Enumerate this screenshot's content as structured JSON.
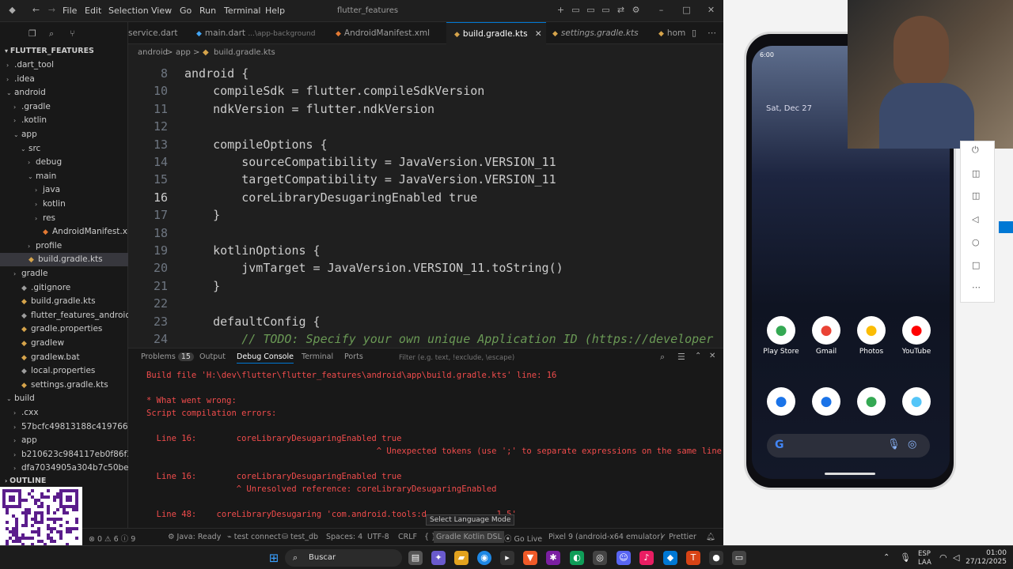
{
  "window": {
    "title": "flutter_features"
  },
  "menu": [
    "File",
    "Edit",
    "Selection",
    "View",
    "Go",
    "Run",
    "Terminal",
    "Help"
  ],
  "tabs": [
    {
      "label": "service.dart",
      "active": false
    },
    {
      "label": "main.dart",
      "hint": "...\\app-background",
      "active": false
    },
    {
      "label": "AndroidManifest.xml",
      "active": false
    },
    {
      "label": "build.gradle.kts",
      "active": true
    },
    {
      "label": "settings.gradle.kts",
      "active": false
    },
    {
      "label": "hom",
      "active": false
    }
  ],
  "breadcrumb": [
    "android",
    ">",
    "app",
    ">",
    "build.gradle.kts"
  ],
  "explorer": {
    "root": "FLUTTER_FEATURES",
    "items": [
      {
        "label": ".dart_tool",
        "depth": 1,
        "chev": ">"
      },
      {
        "label": ".idea",
        "depth": 1,
        "chev": ">"
      },
      {
        "label": "android",
        "depth": 1,
        "chev": "v"
      },
      {
        "label": ".gradle",
        "depth": 2,
        "chev": ">"
      },
      {
        "label": ".kotlin",
        "depth": 2,
        "chev": ">"
      },
      {
        "label": "app",
        "depth": 2,
        "chev": "v"
      },
      {
        "label": "src",
        "depth": 3,
        "chev": "v"
      },
      {
        "label": "debug",
        "depth": 4,
        "chev": ">"
      },
      {
        "label": "main",
        "depth": 4,
        "chev": "v"
      },
      {
        "label": "java",
        "depth": 5,
        "chev": ">"
      },
      {
        "label": "kotlin",
        "depth": 5,
        "chev": ">"
      },
      {
        "label": "res",
        "depth": 5,
        "chev": ">"
      },
      {
        "label": "AndroidManifest.xml",
        "depth": 5,
        "chev": ""
      },
      {
        "label": "profile",
        "depth": 4,
        "chev": ">"
      },
      {
        "label": "build.gradle.kts",
        "depth": 3,
        "chev": "",
        "selected": true
      },
      {
        "label": "gradle",
        "depth": 2,
        "chev": ">"
      },
      {
        "label": ".gitignore",
        "depth": 2,
        "chev": ""
      },
      {
        "label": "build.gradle.kts",
        "depth": 2,
        "chev": ""
      },
      {
        "label": "flutter_features_android.iml",
        "depth": 2,
        "chev": ""
      },
      {
        "label": "gradle.properties",
        "depth": 2,
        "chev": ""
      },
      {
        "label": "gradlew",
        "depth": 2,
        "chev": ""
      },
      {
        "label": "gradlew.bat",
        "depth": 2,
        "chev": ""
      },
      {
        "label": "local.properties",
        "depth": 2,
        "chev": ""
      },
      {
        "label": "settings.gradle.kts",
        "depth": 2,
        "chev": ""
      },
      {
        "label": "build",
        "depth": 1,
        "chev": "v"
      },
      {
        "label": ".cxx",
        "depth": 2,
        "chev": ">"
      },
      {
        "label": "57bcfc49813188c419766...",
        "depth": 2,
        "chev": ">"
      },
      {
        "label": "app",
        "depth": 2,
        "chev": ">"
      },
      {
        "label": "b210623c984117eb0f86f3...",
        "depth": 2,
        "chev": ">"
      },
      {
        "label": "dfa7034905a304b7c50be...",
        "depth": 2,
        "chev": ">"
      }
    ],
    "outline": "OUTLINE"
  },
  "code": [
    {
      "n": "8",
      "t": "android {"
    },
    {
      "n": "10",
      "t": "    compileSdk = flutter.compileSdkVersion"
    },
    {
      "n": "11",
      "t": "    ndkVersion = flutter.ndkVersion"
    },
    {
      "n": "12",
      "t": ""
    },
    {
      "n": "13",
      "t": "    compileOptions {"
    },
    {
      "n": "14",
      "t": "        sourceCompatibility = JavaVersion.VERSION_11"
    },
    {
      "n": "15",
      "t": "        targetCompatibility = JavaVersion.VERSION_11"
    },
    {
      "n": "16",
      "t": "        coreLibraryDesugaringEnabled true",
      "current": true
    },
    {
      "n": "17",
      "t": "    }"
    },
    {
      "n": "18",
      "t": ""
    },
    {
      "n": "19",
      "t": "    kotlinOptions {"
    },
    {
      "n": "20",
      "t": "        jvmTarget = JavaVersion.VERSION_11.toString()"
    },
    {
      "n": "21",
      "t": "    }"
    },
    {
      "n": "22",
      "t": ""
    },
    {
      "n": "23",
      "t": "    defaultConfig {"
    },
    {
      "n": "24",
      "t": "        // TODO: Specify your own unique Application ID (https://developer"
    }
  ],
  "panel": {
    "tabs": [
      "Problems",
      "Output",
      "Debug Console",
      "Terminal",
      "Ports"
    ],
    "problems_count": "15",
    "active_tab": "Debug Console",
    "filter_placeholder": "Filter (e.g. text, !exclude, \\escape)",
    "lines": [
      "Build file 'H:\\dev\\flutter\\flutter_features\\android\\app\\build.gradle.kts' line: 16",
      "",
      "* What went wrong:",
      "Script compilation errors:",
      "",
      "  Line 16:        coreLibraryDesugaringEnabled true",
      "                                              ^ Unexpected tokens (use ';' to separate expressions on the same line)",
      "",
      "  Line 16:        coreLibraryDesugaringEnabled true",
      "                  ^ Unresolved reference: coreLibraryDesugaringEnabled",
      "",
      "  Line 48:    coreLibraryDesugaring 'com.android.tools:d              1.5'"
    ],
    "tooltip": "Select Language Mode"
  },
  "status": {
    "errors": "0",
    "warnings": "6",
    "info": "9",
    "java": "Java: Ready",
    "test": "test connect",
    "db": "test_db",
    "spaces": "Spaces: 4",
    "encoding": "UTF-8",
    "eol": "CRLF",
    "language": "Gradle Kotlin DSL",
    "golive": "Go Live",
    "device": "Pixel 9 (android-x64 emulator)",
    "prettier": "Prettier"
  },
  "phone": {
    "time": "6:00",
    "date": "Sat, Dec 27",
    "apps_row1": [
      {
        "label": "Play Store",
        "icon": "play-store-icon",
        "color": "#34a853"
      },
      {
        "label": "Gmail",
        "icon": "gmail-icon",
        "color": "#ea4335"
      },
      {
        "label": "Photos",
        "icon": "photos-icon",
        "color": "#fbbc04"
      },
      {
        "label": "YouTube",
        "icon": "youtube-icon",
        "color": "#ff0000"
      }
    ],
    "apps_row2": [
      {
        "icon": "phone-icon",
        "color": "#1a73e8"
      },
      {
        "icon": "messages-icon",
        "color": "#1a73e8"
      },
      {
        "icon": "chrome-icon",
        "color": "#34a853"
      },
      {
        "icon": "flutter-app-icon",
        "color": "#54c5f8"
      }
    ]
  },
  "taskbar": {
    "search": "Buscar",
    "lang": "ESP",
    "lang2": "LAA",
    "time": "01:00",
    "date": "27/12/2025"
  }
}
